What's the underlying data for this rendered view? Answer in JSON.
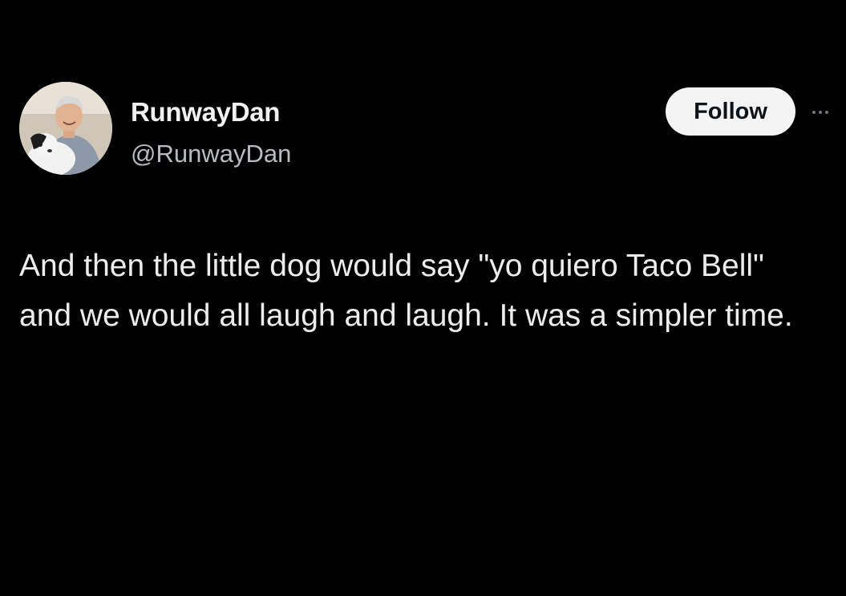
{
  "author": {
    "display_name": "RunwayDan",
    "handle": "@RunwayDan",
    "avatar_icon": "profile-photo-man-with-dog"
  },
  "actions": {
    "follow_label": "Follow",
    "more_icon": "more-options-icon"
  },
  "tweet": {
    "text": "And then the little dog would say \"yo quiero Taco Bell\" and we would all laugh and laugh. It was a simpler time."
  },
  "colors": {
    "background": "#000000",
    "text": "#e7e9ea",
    "handle": "#b8bcc1",
    "follow_bg": "#f4f4f4",
    "follow_text": "#0f1419"
  }
}
